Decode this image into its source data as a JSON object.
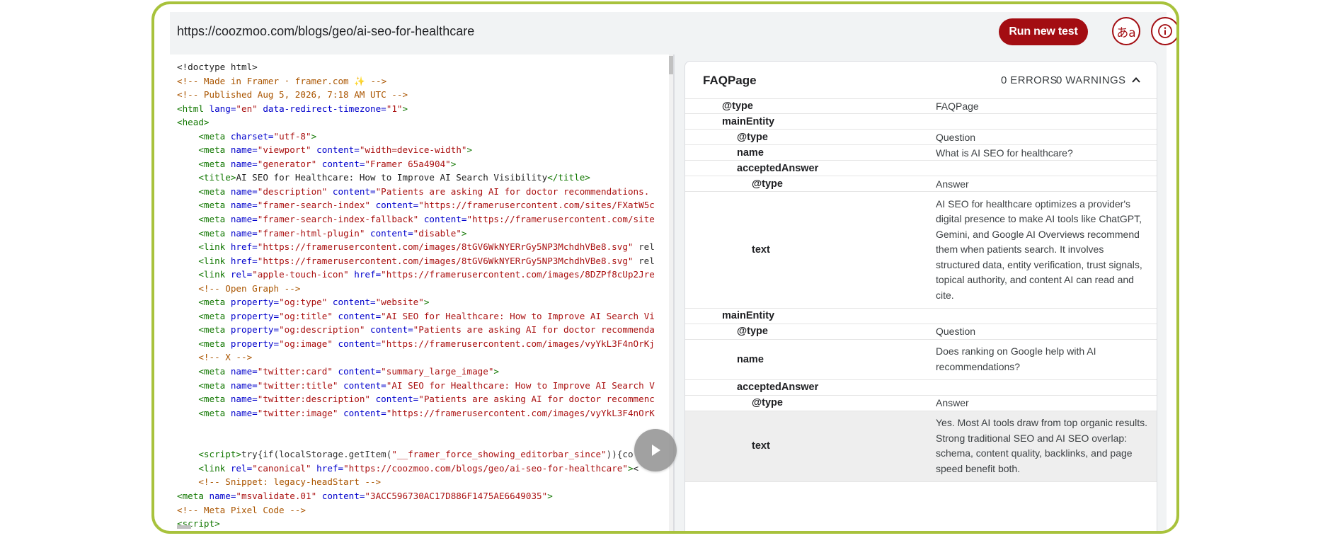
{
  "toolbar": {
    "url": "https://coozmoo.com/blogs/geo/ai-seo-for-healthcare",
    "run_button": "Run new test",
    "lang_button": "あa",
    "info_icon": "info-icon"
  },
  "code": {
    "lines": [
      "<!doctype html>",
      "<!-- Made in Framer · framer.com ✨ -->",
      "<!-- Published Aug 5, 2026, 7:18 AM UTC -->",
      "<html lang=\"en\" data-redirect-timezone=\"1\">",
      "<head>",
      "    <meta charset=\"utf-8\">",
      "    <meta name=\"viewport\" content=\"width=device-width\">",
      "    <meta name=\"generator\" content=\"Framer 65a4904\">",
      "    <title>AI SEO for Healthcare: How to Improve AI Search Visibility</title>",
      "    <meta name=\"description\" content=\"Patients are asking AI for doctor recommendations.",
      "    <meta name=\"framer-search-index\" content=\"https://framerusercontent.com/sites/FXatW5c",
      "    <meta name=\"framer-search-index-fallback\" content=\"https://framerusercontent.com/site",
      "    <meta name=\"framer-html-plugin\" content=\"disable\">",
      "    <link href=\"https://framerusercontent.com/images/8tGV6WkNYERrGy5NP3MchdhVBe8.svg\" rel",
      "    <link href=\"https://framerusercontent.com/images/8tGV6WkNYERrGy5NP3MchdhVBe8.svg\" rel",
      "    <link rel=\"apple-touch-icon\" href=\"https://framerusercontent.com/images/8DZPf8cUp2Jre",
      "    <!-- Open Graph -->",
      "    <meta property=\"og:type\" content=\"website\">",
      "    <meta property=\"og:title\" content=\"AI SEO for Healthcare: How to Improve AI Search Vi",
      "    <meta property=\"og:description\" content=\"Patients are asking AI for doctor recommenda",
      "    <meta property=\"og:image\" content=\"https://framerusercontent.com/images/vyYkL3F4nOrKj",
      "    <!-- X -->",
      "    <meta name=\"twitter:card\" content=\"summary_large_image\">",
      "    <meta name=\"twitter:title\" content=\"AI SEO for Healthcare: How to Improve AI Search V",
      "    <meta name=\"twitter:description\" content=\"Patients are asking AI for doctor recommenc",
      "    <meta name=\"twitter:image\" content=\"https://framerusercontent.com/images/vyYkL3F4nOrK",
      "",
      "",
      "    <script>try{if(localStorage.getItem(\"__framer_force_showing_editorbar_since\")){co",
      "    <link rel=\"canonical\" href=\"https://coozmoo.com/blogs/geo/ai-seo-for-healthcare\"><",
      "    <!-- Snippet: legacy-headStart -->",
      "<meta name=\"msvalidate.01\" content=\"3ACC596730AC17D886F1475AE6649035\">",
      "<!-- Meta Pixel Code -->",
      "<script>"
    ]
  },
  "result": {
    "title": "FAQPage",
    "errors": "0 ERRORS",
    "warnings": "0 WARNINGS",
    "rows": [
      {
        "key": "@type",
        "value": "FAQPage"
      },
      {
        "key": "mainEntity",
        "value": ""
      },
      {
        "key": "@type",
        "value": "Question"
      },
      {
        "key": "name",
        "value": "What is AI SEO for healthcare?"
      },
      {
        "key": "acceptedAnswer",
        "value": ""
      },
      {
        "key": "@type",
        "value": "Answer"
      },
      {
        "key": "text",
        "value": "AI SEO for healthcare optimizes a provider's digital presence to make AI tools like ChatGPT, Gemini, and Google AI Overviews recommend them when patients search. It involves structured data, entity verification, trust signals, topical authority, and content AI can read and cite."
      },
      {
        "key": "mainEntity",
        "value": ""
      },
      {
        "key": "@type",
        "value": "Question"
      },
      {
        "key": "name",
        "value": "Does ranking on Google help with AI recommendations?"
      },
      {
        "key": "acceptedAnswer",
        "value": ""
      },
      {
        "key": "@type",
        "value": "Answer"
      },
      {
        "key": "text",
        "value": "Yes. Most AI tools draw from top organic results. Strong traditional SEO and AI SEO overlap: schema, content quality, backlinks, and page speed benefit both."
      }
    ]
  },
  "player": {
    "icon": "play-icon"
  }
}
